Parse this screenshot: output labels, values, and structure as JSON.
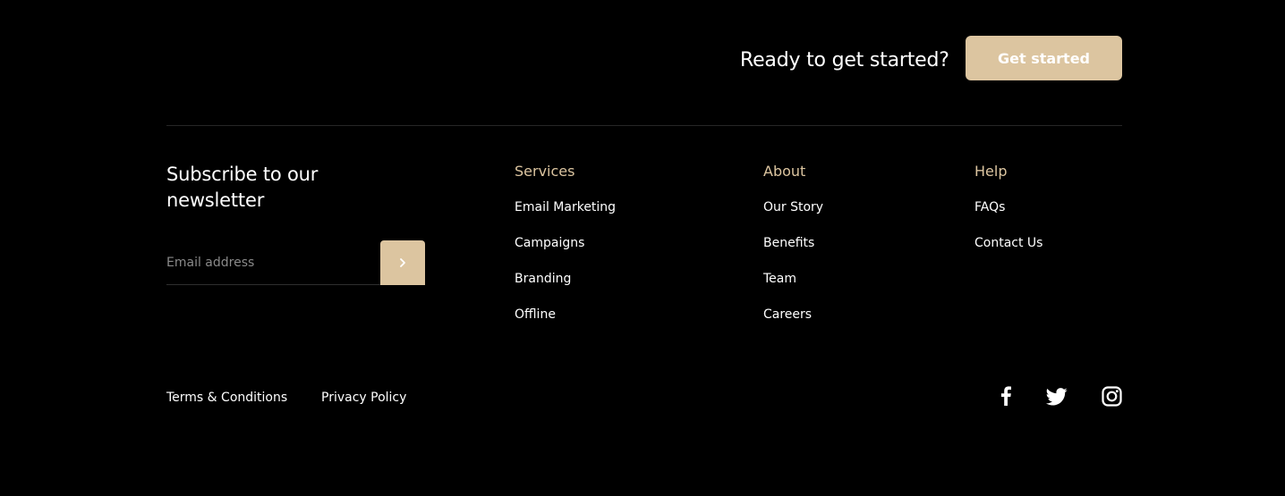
{
  "colors": {
    "background": "#000000",
    "accent": "#dcc5a0",
    "text": "#ffffff",
    "muted": "#8a8a8a"
  },
  "cta": {
    "text": "Ready to get started?",
    "button_label": "Get started"
  },
  "newsletter": {
    "title": "Subscribe to our newsletter",
    "email_placeholder": "Email address",
    "submit_icon": "chevron-right-icon"
  },
  "nav": {
    "services": {
      "heading": "Services",
      "links": [
        "Email Marketing",
        "Campaigns",
        "Branding",
        "Offline"
      ]
    },
    "about": {
      "heading": "About",
      "links": [
        "Our Story",
        "Benefits",
        "Team",
        "Careers"
      ]
    },
    "help": {
      "heading": "Help",
      "links": [
        "FAQs",
        "Contact Us"
      ]
    }
  },
  "legal": {
    "terms": "Terms & Conditions",
    "privacy": "Privacy Policy"
  },
  "social": [
    "facebook-icon",
    "twitter-icon",
    "instagram-icon"
  ]
}
